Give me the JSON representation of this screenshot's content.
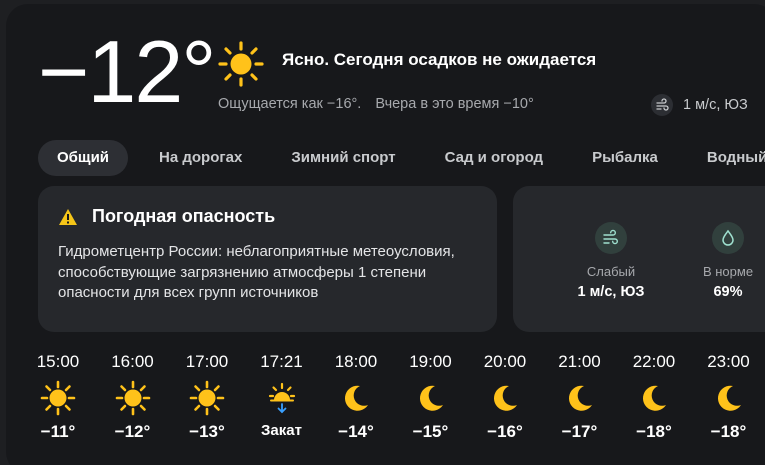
{
  "current": {
    "temperature": "−12°",
    "condition": "Ясно. Сегодня осадков не ожидается",
    "feels_like": "Ощущается как −16°.",
    "yesterday": "Вчера в это время −10°",
    "wind": "1 м/с, ЮЗ",
    "icon": "sun-icon"
  },
  "tabs": [
    "Общий",
    "На дорогах",
    "Зимний спорт",
    "Сад и огород",
    "Рыбалка",
    "Водный"
  ],
  "active_tab": "Общий",
  "warning": {
    "title": "Погодная опасность",
    "icon": "warning-icon",
    "text": "Гидрометцентр России: неблагоприятные метеоусловия, способствующие загрязнению атмосферы 1 степени опасности для всех групп источников",
    "icon_color": "#f5c518"
  },
  "metrics": [
    {
      "label": "Слабый",
      "value": "1 м/с, ЮЗ",
      "icon": "wind-icon"
    },
    {
      "label": "В норме",
      "value": "69%",
      "icon": "humidity-drop-icon"
    }
  ],
  "hourly": [
    {
      "time": "15:00",
      "temp": "−11°",
      "icon": "sun"
    },
    {
      "time": "16:00",
      "temp": "−12°",
      "icon": "sun"
    },
    {
      "time": "17:00",
      "temp": "−13°",
      "icon": "sun"
    },
    {
      "time": "17:21",
      "temp": "Закат",
      "icon": "sunset"
    },
    {
      "time": "18:00",
      "temp": "−14°",
      "icon": "moon"
    },
    {
      "time": "19:00",
      "temp": "−15°",
      "icon": "moon"
    },
    {
      "time": "20:00",
      "temp": "−16°",
      "icon": "moon"
    },
    {
      "time": "21:00",
      "temp": "−17°",
      "icon": "moon"
    },
    {
      "time": "22:00",
      "temp": "−18°",
      "icon": "moon"
    },
    {
      "time": "23:00",
      "temp": "−18°",
      "icon": "moon"
    }
  ],
  "colors": {
    "sun": "#ffc21a",
    "moon": "#ffc21a",
    "accent": "#3aa0ff"
  }
}
